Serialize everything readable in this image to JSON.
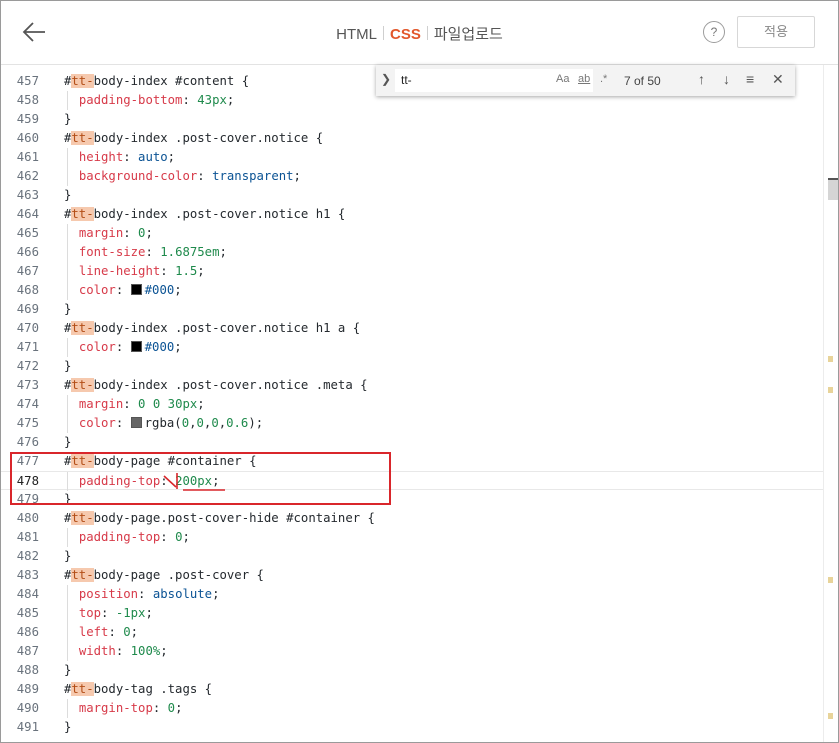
{
  "header": {
    "tabs": [
      {
        "label": "HTML",
        "active": false
      },
      {
        "label": "CSS",
        "active": true
      },
      {
        "label": "파일업로드",
        "active": false
      }
    ],
    "help_label": "?",
    "apply_label": "적용"
  },
  "find": {
    "query": "tt-",
    "case_label": "Aa",
    "word_label": "ab",
    "regex_label": ".*",
    "count_label": "7 of 50",
    "toggle_icon": "chevron-right-icon",
    "prev_icon": "arrow-up-icon",
    "next_icon": "arrow-down-icon",
    "selection_icon": "lines-icon",
    "close_icon": "close-icon"
  },
  "editor": {
    "lines": [
      {
        "n": "457",
        "t": "#tt-body-index #content {"
      },
      {
        "n": "458",
        "t": "  padding-bottom: 43px;"
      },
      {
        "n": "459",
        "t": "}"
      },
      {
        "n": "460",
        "t": "#tt-body-index .post-cover.notice {"
      },
      {
        "n": "461",
        "t": "  height: auto;"
      },
      {
        "n": "462",
        "t": "  background-color: transparent;"
      },
      {
        "n": "463",
        "t": "}"
      },
      {
        "n": "464",
        "t": "#tt-body-index .post-cover.notice h1 {"
      },
      {
        "n": "465",
        "t": "  margin: 0;"
      },
      {
        "n": "466",
        "t": "  font-size: 1.6875em;"
      },
      {
        "n": "467",
        "t": "  line-height: 1.5;"
      },
      {
        "n": "468",
        "t": "  color: #000;"
      },
      {
        "n": "469",
        "t": "}"
      },
      {
        "n": "470",
        "t": "#tt-body-index .post-cover.notice h1 a {"
      },
      {
        "n": "471",
        "t": "  color: #000;"
      },
      {
        "n": "472",
        "t": "}"
      },
      {
        "n": "473",
        "t": "#tt-body-index .post-cover.notice .meta {"
      },
      {
        "n": "474",
        "t": "  margin: 0 0 30px;"
      },
      {
        "n": "475",
        "t": "  color: rgba(0,0,0,0.6);"
      },
      {
        "n": "476",
        "t": "}"
      },
      {
        "n": "477",
        "t": "#tt-body-page #container {"
      },
      {
        "n": "478",
        "t": "  padding-top: 200px;"
      },
      {
        "n": "479",
        "t": "}"
      },
      {
        "n": "480",
        "t": "#tt-body-page.post-cover-hide #container {"
      },
      {
        "n": "481",
        "t": "  padding-top: 0;"
      },
      {
        "n": "482",
        "t": "}"
      },
      {
        "n": "483",
        "t": "#tt-body-page .post-cover {"
      },
      {
        "n": "484",
        "t": "  position: absolute;"
      },
      {
        "n": "485",
        "t": "  top: -1px;"
      },
      {
        "n": "486",
        "t": "  left: 0;"
      },
      {
        "n": "487",
        "t": "  width: 100%;"
      },
      {
        "n": "488",
        "t": "}"
      },
      {
        "n": "489",
        "t": "#tt-body-tag .tags {"
      },
      {
        "n": "490",
        "t": "  margin-top: 0;"
      },
      {
        "n": "491",
        "t": "}"
      }
    ],
    "current_line": "478",
    "highlighted_lines": [
      "477",
      "478",
      "479"
    ]
  },
  "colors": {
    "accent": "#e2572b",
    "match_highlight": "#f6c9ae",
    "annotation_red": "#d9262b",
    "property": "#d73a49",
    "number": "#1f8a4c",
    "keyword": "#0b5394"
  }
}
